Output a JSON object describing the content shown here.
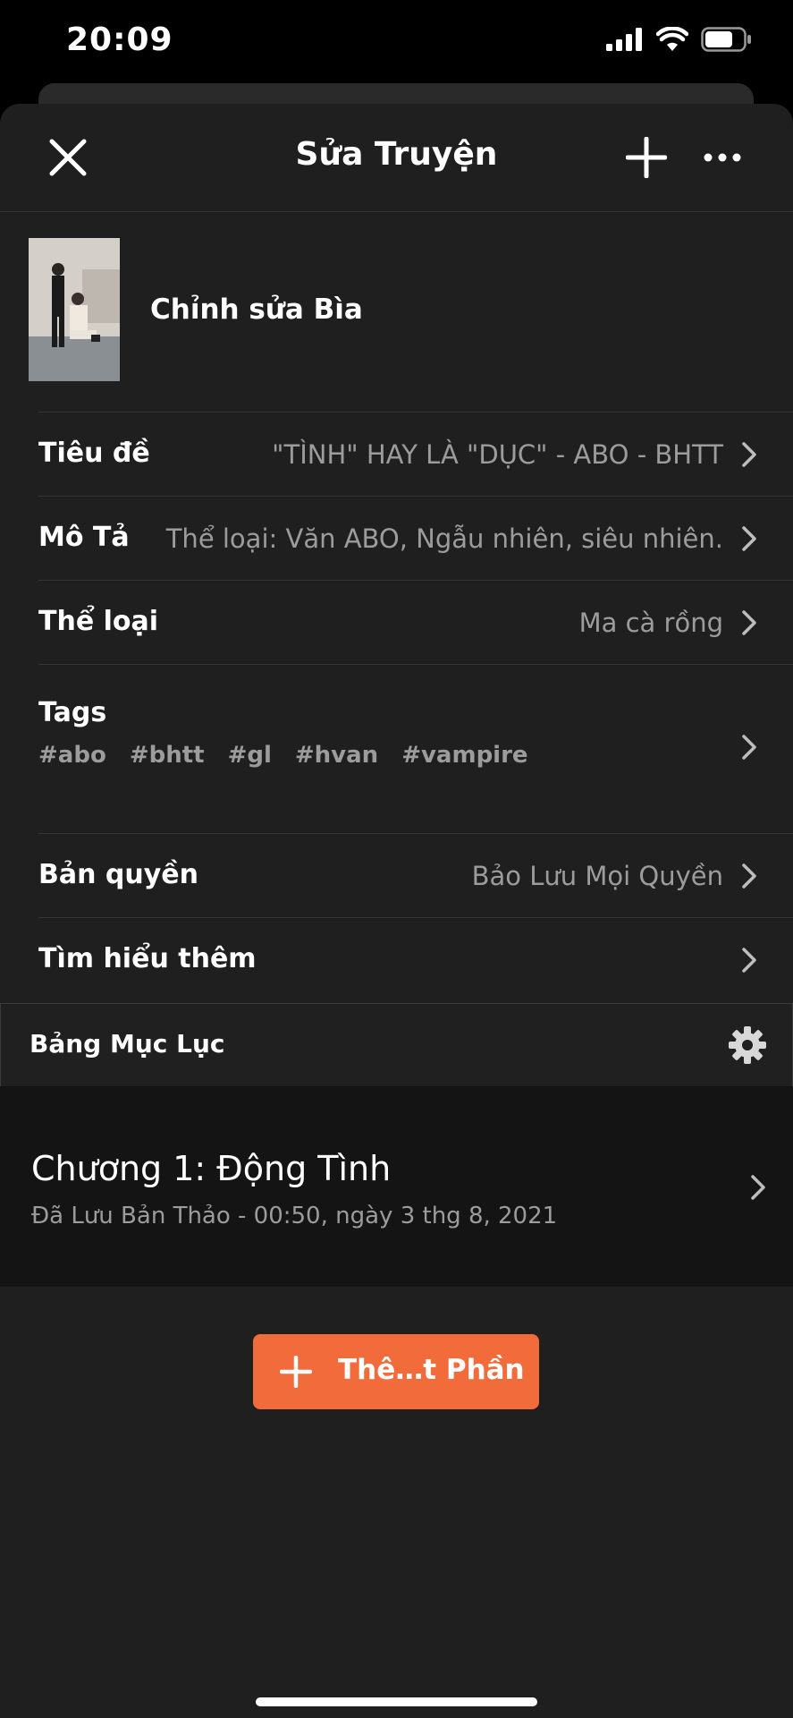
{
  "status": {
    "time": "20:09"
  },
  "nav": {
    "title": "Sửa Truyện"
  },
  "cover": {
    "label": "Chỉnh sửa Bìa"
  },
  "details": [
    {
      "label": "Tiêu đề",
      "value": "\"TÌNH\" HAY LÀ \"DỤC\" - ABO - BHTT"
    },
    {
      "label": "Mô Tả",
      "value": "Thể loại: Văn ABO, Ngẫu nhiên, siêu nhiên."
    },
    {
      "label": "Thể loại",
      "value": "Ma cà rồng"
    }
  ],
  "tags": {
    "label": "Tags",
    "items": [
      "#abo",
      "#bhtt",
      "#gl",
      "#hvan",
      "#vampire"
    ]
  },
  "copyright": {
    "label": "Bản quyền",
    "value": "Bảo Lưu Mọi Quyền"
  },
  "learn_more": {
    "label": "Tìm hiểu thêm"
  },
  "toc": {
    "label": "Bảng Mục Lục"
  },
  "chapters": [
    {
      "title": "Chương 1: Động Tình",
      "subtitle": "Đã Lưu Bản Thảo - 00:50, ngày 3 thg 8, 2021"
    }
  ],
  "add_part": {
    "label": "Thê…t Phần"
  },
  "colors": {
    "accent": "#f26b3a",
    "sheet": "#1f1f1f",
    "muted": "#9c9c9c"
  }
}
